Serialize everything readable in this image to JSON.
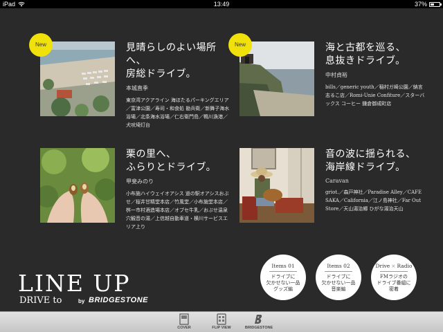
{
  "status_bar": {
    "carrier": "iPad",
    "time": "13:49",
    "battery_percent": "37%",
    "battery_level": 0.37
  },
  "cards": [
    {
      "badge": "New",
      "title_line1": "見晴らしのよい場所へ、",
      "title_line2": "房総ドライブ。",
      "author": "本城直季",
      "desc": "東京湾アクアライン 海ほたるパーキングエリア／富津公園／寿司・和食処 勘兵衛／新舞子海水浴場／北条海水浴場／仁右衛門島／鴨川漁港／犬吠埼灯台"
    },
    {
      "badge": "New",
      "title_line1": "海と古都を巡る、",
      "title_line2": "息抜きドライブ。",
      "author": "中村貞裕",
      "desc": "bills／generic youth／稲村ガ崎公園／納言 志るこ店／Romi-Unie Confiture／スターバックス コーヒー 鎌倉御成町店"
    },
    {
      "badge": "",
      "title_line1": "栗の里へ、",
      "title_line2": "ふらりとドライブ。",
      "author": "甲斐みのり",
      "desc": "小布施ハイウェイオアシス 道の駅オアシスおぶせ／桜井甘精堂本店／竹風堂／小布施堂本店／桝一市村酒造場本店／オブセ牛乳／おぶせ温泉 穴観音の湯／上信越自動車道・横川サービスエリア上り"
    },
    {
      "badge": "",
      "title_line1": "音の波に揺られる、",
      "title_line2": "海岸線ドライブ。",
      "author": "Caravan",
      "desc": "griot.／森戸神社／Paradise Alley／CAFE SAKA／California／江ノ島神社／Far Out Store／天山湯治郷 ひがな湯治天山"
    }
  ],
  "round_buttons": [
    {
      "head_a": "Items 01",
      "head_sep": "",
      "head_b": "",
      "lines": [
        "ドライブに",
        "欠かせない一品",
        "グッズ編"
      ]
    },
    {
      "head_a": "Items 02",
      "head_sep": "",
      "head_b": "",
      "lines": [
        "ドライブに",
        "欠かせない一品",
        "音楽編"
      ]
    },
    {
      "head_a": "Drive",
      "head_sep": "×",
      "head_b": "Radio",
      "lines": [
        "FMラジオの",
        "ドライブ番組に",
        "密着"
      ]
    }
  ],
  "lineup": {
    "title": "LINE UP",
    "drive": "DRIVE to",
    "by": "by",
    "brand": "BRIDGESTONE"
  },
  "toolbar": {
    "items": [
      {
        "label": "COVER",
        "icon": "cover-icon"
      },
      {
        "label": "FLIP VIEW",
        "icon": "flip-view-icon"
      },
      {
        "label": "BRIDGESTONE",
        "icon": "bridgestone-icon"
      }
    ]
  },
  "colors": {
    "background": "#2b2a2b",
    "badge": "#f1e10a",
    "toolbar": "#d4d4d4"
  }
}
